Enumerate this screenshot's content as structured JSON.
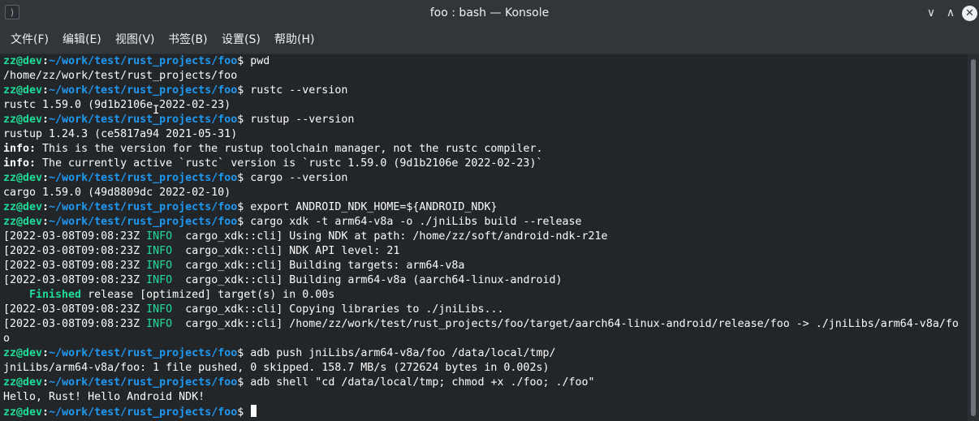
{
  "window": {
    "title": "foo : bash — Konsole",
    "icon_symbol": "⟩",
    "minimize_symbol": "∨",
    "maximize_symbol": "∧",
    "close_symbol": "✕"
  },
  "menu": {
    "items": [
      "文件(F)",
      "编辑(E)",
      "视图(V)",
      "书签(B)",
      "设置(S)",
      "帮助(H)"
    ]
  },
  "prompt": {
    "user": "zz@dev",
    "path": "~/work/test/rust_projects/foo",
    "symbol": "$ "
  },
  "terminal": {
    "lines": [
      {
        "type": "prompt",
        "command": "pwd"
      },
      {
        "type": "text",
        "text": "/home/zz/work/test/rust_projects/foo"
      },
      {
        "type": "prompt",
        "command": "rustc --version"
      },
      {
        "type": "text",
        "text": "rustc 1.59.0 (9d1b2106e 2022-02-23)"
      },
      {
        "type": "prompt",
        "command": "rustup --version"
      },
      {
        "type": "text",
        "text": "rustup 1.24.3 (ce5817a94 2021-05-31)"
      },
      {
        "type": "info",
        "label": "info:",
        "text": " This is the version for the rustup toolchain manager, not the rustc compiler."
      },
      {
        "type": "info",
        "label": "info:",
        "text": " The currently active `rustc` version is `rustc 1.59.0 (9d1b2106e 2022-02-23)`"
      },
      {
        "type": "prompt",
        "command": "cargo --version"
      },
      {
        "type": "text",
        "text": "cargo 1.59.0 (49d8809dc 2022-02-10)"
      },
      {
        "type": "prompt",
        "command": "export ANDROID_NDK_HOME=${ANDROID_NDK}"
      },
      {
        "type": "prompt",
        "command": "cargo xdk -t arm64-v8a -o ./jniLibs build --release"
      },
      {
        "type": "log",
        "ts": "2022-03-08T09:08:23Z",
        "level": "INFO",
        "module": "cargo_xdk::cli",
        "msg": " Using NDK at path: /home/zz/soft/android-ndk-r21e"
      },
      {
        "type": "log",
        "ts": "2022-03-08T09:08:23Z",
        "level": "INFO",
        "module": "cargo_xdk::cli",
        "msg": " NDK API level: 21"
      },
      {
        "type": "log",
        "ts": "2022-03-08T09:08:23Z",
        "level": "INFO",
        "module": "cargo_xdk::cli",
        "msg": " Building targets: arm64-v8a"
      },
      {
        "type": "log",
        "ts": "2022-03-08T09:08:23Z",
        "level": "INFO",
        "module": "cargo_xdk::cli",
        "msg": " Building arm64-v8a (aarch64-linux-android)"
      },
      {
        "type": "finished",
        "label": "    Finished",
        "text": " release [optimized] target(s) in 0.00s"
      },
      {
        "type": "log",
        "ts": "2022-03-08T09:08:23Z",
        "level": "INFO",
        "module": "cargo_xdk::cli",
        "msg": " Copying libraries to ./jniLibs..."
      },
      {
        "type": "log",
        "ts": "2022-03-08T09:08:23Z",
        "level": "INFO",
        "module": "cargo_xdk::cli",
        "msg": " /home/zz/work/test/rust_projects/foo/target/aarch64-linux-android/release/foo -> ./jniLibs/arm64-v8a/fo"
      },
      {
        "type": "text",
        "text": "o"
      },
      {
        "type": "prompt",
        "command": "adb push jniLibs/arm64-v8a/foo /data/local/tmp/"
      },
      {
        "type": "text",
        "text": "jniLibs/arm64-v8a/foo: 1 file pushed, 0 skipped. 158.7 MB/s (272624 bytes in 0.002s)"
      },
      {
        "type": "prompt",
        "command": "adb shell \"cd /data/local/tmp; chmod +x ./foo; ./foo\""
      },
      {
        "type": "text",
        "text": "Hello, Rust! Hello Android NDK!"
      },
      {
        "type": "prompt",
        "command": "",
        "cursor": true
      }
    ]
  },
  "colors": {
    "background": "#232629",
    "titlebar": "#31363b",
    "prompt_user": "#1cdc9a",
    "prompt_path": "#1d99f3",
    "info_level": "#1cdc9a",
    "text": "#fcfcfc"
  }
}
